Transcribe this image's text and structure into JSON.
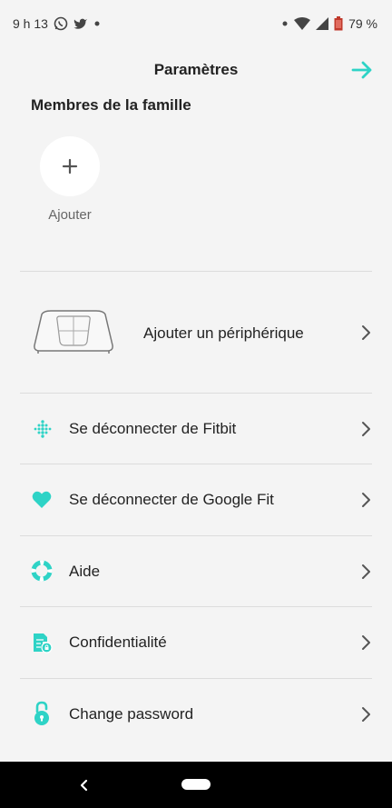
{
  "status_bar": {
    "time": "9 h 13",
    "battery": "79 %"
  },
  "header": {
    "title": "Paramètres"
  },
  "family": {
    "section_title": "Membres de la famille",
    "add_label": "Ajouter"
  },
  "device_row": {
    "label": "Ajouter un périphérique"
  },
  "menu": [
    {
      "label": "Se déconnecter de Fitbit",
      "icon": "fitbit-icon"
    },
    {
      "label": "Se déconnecter de Google Fit",
      "icon": "heart-icon"
    },
    {
      "label": "Aide",
      "icon": "lifebuoy-icon"
    },
    {
      "label": "Confidentialité",
      "icon": "privacy-icon"
    },
    {
      "label": "Change password",
      "icon": "lock-icon"
    }
  ],
  "colors": {
    "accent": "#2ed3c6",
    "background": "#f4f4f4",
    "divider": "#dcdcdc"
  }
}
